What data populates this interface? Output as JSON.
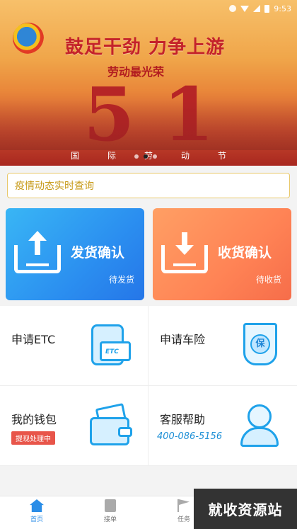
{
  "status_bar": {
    "time": "9:53"
  },
  "banner": {
    "slogan": "鼓足干劲  力争上游",
    "subslogan": "劳动最光荣",
    "big_number": "51",
    "holiday_chars": [
      "国",
      "际",
      "劳",
      "动",
      "节"
    ],
    "active_slide_index": 1,
    "slide_count": 3
  },
  "search": {
    "label": "疫情动态实时查询"
  },
  "cards": {
    "ship": {
      "title": "发货确认",
      "sub": "待发货",
      "color": "#2b8ff0"
    },
    "receive": {
      "title": "收货确认",
      "sub": "待收货",
      "color": "#ff8355"
    }
  },
  "grid": {
    "etc": {
      "title": "申请ETC",
      "icon_text": "ETC"
    },
    "insurance": {
      "title": "申请车险",
      "icon_text": "保"
    },
    "wallet": {
      "title": "我的钱包",
      "badge": "提现处理中"
    },
    "service": {
      "title": "客服帮助",
      "phone": "400-086-5156"
    }
  },
  "tabbar": {
    "items": [
      {
        "label": "首页",
        "active": true
      },
      {
        "label": "接单",
        "active": false
      },
      {
        "label": "任务",
        "active": false
      }
    ]
  },
  "watermark": "就收资源站",
  "colors": {
    "accent": "#2a8de7",
    "badge": "#e8554a",
    "search_border": "#e8c86b"
  }
}
